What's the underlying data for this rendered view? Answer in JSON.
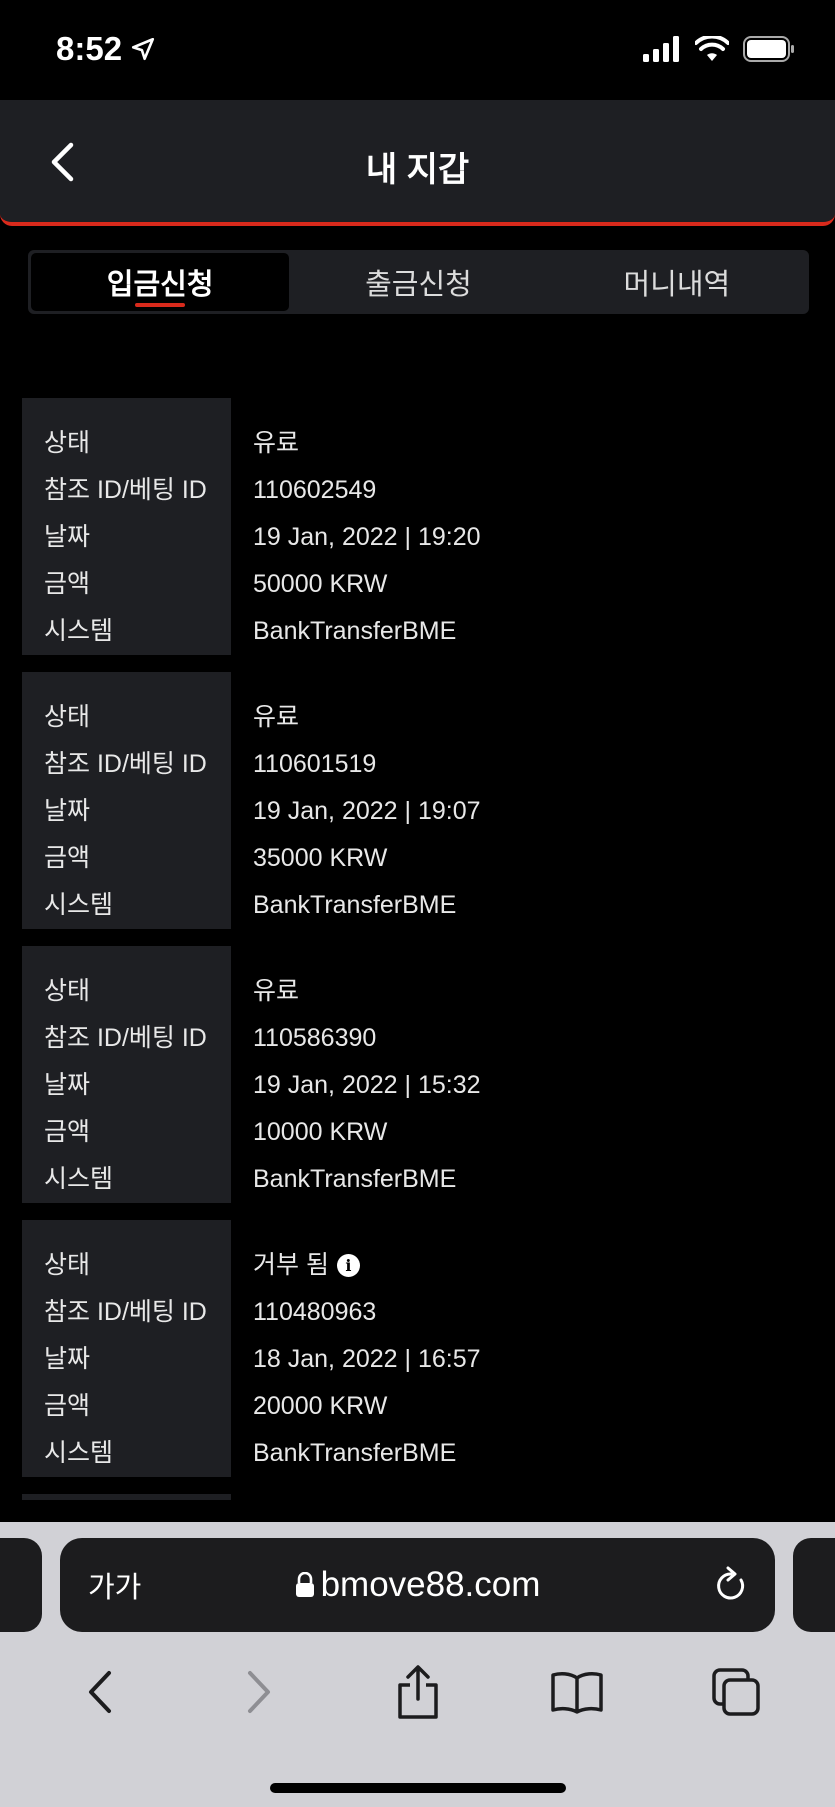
{
  "status_bar": {
    "time": "8:52"
  },
  "header": {
    "title": "내 지갑"
  },
  "tabs": [
    {
      "label": "입금신청",
      "active": true
    },
    {
      "label": "출금신청",
      "active": false
    },
    {
      "label": "머니내역",
      "active": false
    }
  ],
  "field_labels": {
    "status": "상태",
    "ref_id": "참조 ID/베팅 ID",
    "date": "날짜",
    "amount": "금액",
    "system": "시스템"
  },
  "records": [
    {
      "status": "유료",
      "ref_id": "110602549",
      "date": "19 Jan, 2022 | 19:20",
      "amount": "50000 KRW",
      "system": "BankTransferBME",
      "info_icon": false
    },
    {
      "status": "유료",
      "ref_id": "110601519",
      "date": "19 Jan, 2022 | 19:07",
      "amount": "35000 KRW",
      "system": "BankTransferBME",
      "info_icon": false
    },
    {
      "status": "유료",
      "ref_id": "110586390",
      "date": "19 Jan, 2022 | 15:32",
      "amount": "10000 KRW",
      "system": "BankTransferBME",
      "info_icon": false
    },
    {
      "status": "거부 됨",
      "ref_id": "110480963",
      "date": "18 Jan, 2022 | 16:57",
      "amount": "20000 KRW",
      "system": "BankTransferBME",
      "info_icon": true
    }
  ],
  "browser": {
    "text_size_label": "가가",
    "url": "bmove88.com"
  },
  "colors": {
    "accent": "#d92a1c",
    "panel": "#1e1f23",
    "background": "#000000"
  }
}
